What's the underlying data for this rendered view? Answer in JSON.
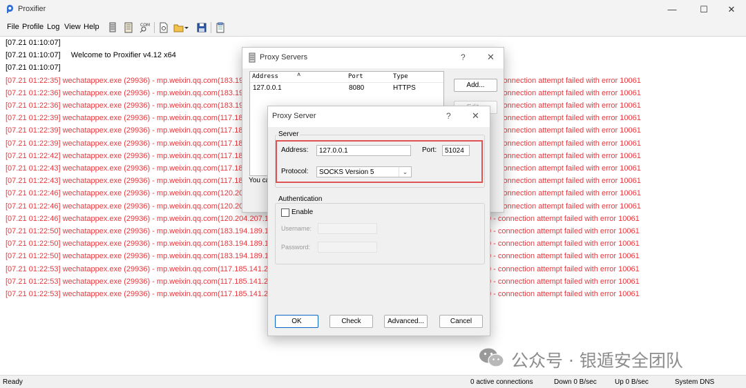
{
  "window": {
    "title": "Proxifier",
    "minimize": "—",
    "maximize": "☐",
    "close": "✕"
  },
  "menu": [
    "File",
    "Profile",
    "Log",
    "View",
    "Help"
  ],
  "log": {
    "info_lines": [
      "[07.21 01:10:07]",
      "[07.21 01:10:07]     Welcome to Proxifier v4.12 x64",
      "[07.21 01:10:07]"
    ],
    "error_lines": [
      {
        "text": "[07.21 01:22:35] wechatappex.exe (29936) - mp.weixin.qq.com(183.19",
        "tail": "connection attempt failed with error 10061"
      },
      {
        "text": "[07.21 01:22:36] wechatappex.exe (29936) - mp.weixin.qq.com(183.19",
        "tail": "connection attempt failed with error 10061"
      },
      {
        "text": "[07.21 01:22:36] wechatappex.exe (29936) - mp.weixin.qq.com(183.19",
        "tail": "connection attempt failed with error 10061"
      },
      {
        "text": "[07.21 01:22:39] wechatappex.exe (29936) - mp.weixin.qq.com(117.18",
        "tail": "connection attempt failed with error 10061"
      },
      {
        "text": "[07.21 01:22:39] wechatappex.exe (29936) - mp.weixin.qq.com(117.18",
        "tail": "connection attempt failed with error 10061"
      },
      {
        "text": "[07.21 01:22:39] wechatappex.exe (29936) - mp.weixin.qq.com(117.18",
        "tail": "connection attempt failed with error 10061"
      },
      {
        "text": "[07.21 01:22:42] wechatappex.exe (29936) - mp.weixin.qq.com(117.18",
        "tail": "connection attempt failed with error 10061"
      },
      {
        "text": "[07.21 01:22:43] wechatappex.exe (29936) - mp.weixin.qq.com(117.18",
        "tail": "connection attempt failed with error 10061"
      },
      {
        "text": "[07.21 01:22:43] wechatappex.exe (29936) - mp.weixin.qq.com(117.18",
        "tail": "connection attempt failed with error 10061"
      },
      {
        "text": "[07.21 01:22:46] wechatappex.exe (29936) - mp.weixin.qq.com(120.20",
        "tail": "connection attempt failed with error 10061"
      },
      {
        "text": "[07.21 01:22:46] wechatappex.exe (29936) - mp.weixin.qq.com(120.20",
        "tail": "connection attempt failed with error 10061"
      },
      {
        "text": "[07.21 01:22:46] wechatappex.exe (29936) - mp.weixin.qq.com(120.204.207.1",
        "tail": "0 - connection attempt failed with error 10061"
      },
      {
        "text": "[07.21 01:22:50] wechatappex.exe (29936) - mp.weixin.qq.com(183.194.189.1",
        "tail": "0 - connection attempt failed with error 10061"
      },
      {
        "text": "[07.21 01:22:50] wechatappex.exe (29936) - mp.weixin.qq.com(183.194.189.1",
        "tail": "0 - connection attempt failed with error 10061"
      },
      {
        "text": "[07.21 01:22:50] wechatappex.exe (29936) - mp.weixin.qq.com(183.194.189.1",
        "tail": "0 - connection attempt failed with error 10061"
      },
      {
        "text": "[07.21 01:22:53] wechatappex.exe (29936) - mp.weixin.qq.com(117.185.141.2",
        "tail": "0 - connection attempt failed with error 10061"
      },
      {
        "text": "[07.21 01:22:53] wechatappex.exe (29936) - mp.weixin.qq.com(117.185.141.2",
        "tail": "0 - connection attempt failed with error 10061"
      },
      {
        "text": "[07.21 01:22:53] wechatappex.exe (29936) - mp.weixin.qq.com(117.185.141.2",
        "tail": "0 - connection attempt failed with error 10061"
      }
    ]
  },
  "status": {
    "ready": "Ready",
    "connections": "0 active connections",
    "down": "Down 0 B/sec",
    "up": "Up 0 B/sec",
    "dns": "System DNS"
  },
  "proxy_servers": {
    "title": "Proxy Servers",
    "help": "?",
    "close": "✕",
    "columns": [
      "Address",
      "Port",
      "Type"
    ],
    "rows": [
      {
        "address": "127.0.0.1",
        "port": "8080",
        "type": "HTTPS"
      }
    ],
    "add_button": "Add...",
    "edit_button": "Edit...",
    "note_partial": "You ca"
  },
  "proxy_server": {
    "title": "Proxy Server",
    "help": "?",
    "close": "✕",
    "server_group": "Server",
    "address_label": "Address:",
    "address_value": "127.0.0.1",
    "port_label": "Port:",
    "port_value": "51024",
    "protocol_label": "Protocol:",
    "protocol_value": "SOCKS Version 5",
    "auth_group": "Authentication",
    "enable_label": "Enable",
    "username_label": "Username:",
    "password_label": "Password:",
    "ok": "OK",
    "check": "Check",
    "advanced": "Advanced...",
    "cancel": "Cancel"
  },
  "watermark": {
    "text": "公众号 · 银遁安全团队"
  },
  "colors": {
    "error": "#e8363c",
    "highlight": "#e05252",
    "default_button": "#0a64c8"
  }
}
